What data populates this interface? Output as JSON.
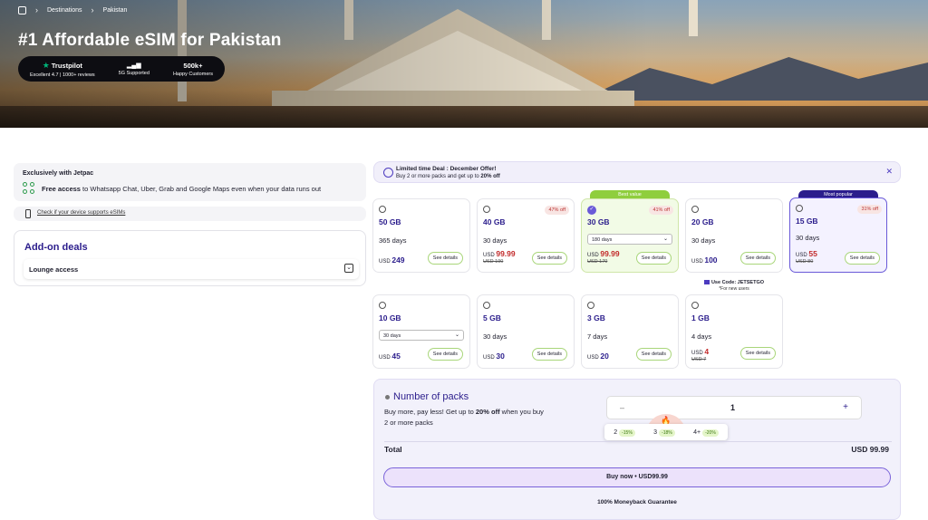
{
  "breadcrumb": {
    "items": [
      "Destinations",
      "Pakistan"
    ]
  },
  "hero": {
    "title": "#1 Affordable eSIM for Pakistan",
    "stats": [
      {
        "top": "Trustpilot",
        "bottom": "Excellent 4.7 | 1000+ reviews"
      },
      {
        "top": "",
        "bottom": "5G Supported"
      },
      {
        "top": "500k+",
        "bottom": "Happy Customers"
      }
    ]
  },
  "exclusive": {
    "title": "Exclusively with Jetpac",
    "bold": "Free access",
    "text": " to Whatsapp Chat, Uber, Grab and Google Maps even when your data runs out"
  },
  "compat_link": "Check if your device supports eSIMs",
  "addons": {
    "title": "Add-on deals",
    "item": "Lounge access"
  },
  "deal": {
    "title": "Limited time Deal : December Offer!",
    "text_pre": "Buy 2 or more packs and get up to ",
    "text_bold": "20% off"
  },
  "details_label": "See details",
  "currency": "USD",
  "plans": [
    {
      "gb": "50 GB",
      "days": "365 days",
      "price": "249",
      "old": "",
      "off": ""
    },
    {
      "gb": "40 GB",
      "days": "30 days",
      "price": "99.99",
      "old": "USD 190",
      "off": "47% off"
    },
    {
      "gb": "30 GB",
      "days": "180 days",
      "price": "99.99",
      "old": "USD 170",
      "off": "41% off",
      "badge": "Best value"
    },
    {
      "gb": "20 GB",
      "days": "30 days",
      "price": "100",
      "old": "",
      "off": ""
    },
    {
      "gb": "15 GB",
      "days": "30 days",
      "price": "55",
      "old": "USD 80",
      "off": "31% off",
      "badge": "Most popular"
    },
    {
      "gb": "10 GB",
      "days": "30 days",
      "price": "45",
      "old": "",
      "off": ""
    },
    {
      "gb": "5 GB",
      "days": "30 days",
      "price": "30",
      "old": "",
      "off": ""
    },
    {
      "gb": "3 GB",
      "days": "7 days",
      "price": "20",
      "old": "",
      "off": ""
    },
    {
      "gb": "1 GB",
      "days": "4 days",
      "price": "4",
      "old": "USD 7",
      "off": ""
    }
  ],
  "promo": {
    "code": "Use Code: JETSETGO",
    "note": "*For new users"
  },
  "packs": {
    "title": "Number of packs",
    "desc_pre": "Buy more, pay less! Get up to ",
    "desc_bold": "20% off",
    "desc_post": " when you buy 2 or more packs",
    "minus": "–",
    "value": "1",
    "plus": "+",
    "fire": "🔥",
    "tiers": [
      {
        "n": "2",
        "pct": "-15%"
      },
      {
        "n": "3",
        "pct": "-18%"
      },
      {
        "n": "4+",
        "pct": "-20%"
      }
    ],
    "total_label": "Total",
    "total_value": "USD 99.99",
    "buy_label": "Buy now • USD99.99",
    "guarantee": "100% Moneyback Guarantee"
  },
  "colors": {
    "accent": "#2b1d8c",
    "highlight": "#6a5ad8",
    "best": "#8fce3d",
    "sale": "#c22b2b"
  }
}
